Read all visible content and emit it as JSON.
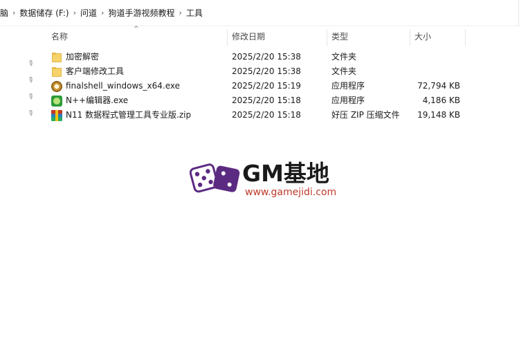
{
  "breadcrumb": {
    "items": [
      "脑",
      "数据储存 (F:)",
      "问道",
      "狗道手游视频教程",
      "工具"
    ]
  },
  "columns": {
    "name": "名称",
    "date": "修改日期",
    "type": "类型",
    "size": "大小"
  },
  "files": [
    {
      "name": "加密解密",
      "date": "2025/2/20 15:38",
      "type": "文件夹",
      "size": "",
      "icon": "folder-icon"
    },
    {
      "name": "客户端修改工具",
      "date": "2025/2/20 15:38",
      "type": "文件夹",
      "size": "",
      "icon": "folder-icon"
    },
    {
      "name": "finalshell_windows_x64.exe",
      "date": "2025/2/20 15:19",
      "type": "应用程序",
      "size": "72,794 KB",
      "icon": "finalshell-app-icon"
    },
    {
      "name": "N++编辑器.exe",
      "date": "2025/2/20 15:18",
      "type": "应用程序",
      "size": "4,186 KB",
      "icon": "notepad-plus-plus-icon"
    },
    {
      "name": "N11 数据程式管理工具专业版.zip",
      "date": "2025/2/20 15:18",
      "type": "好压 ZIP 压缩文件",
      "size": "19,148 KB",
      "icon": "zip-archive-icon"
    }
  ],
  "watermark": {
    "title": "GM基地",
    "url": "www.gamejidi.com"
  }
}
